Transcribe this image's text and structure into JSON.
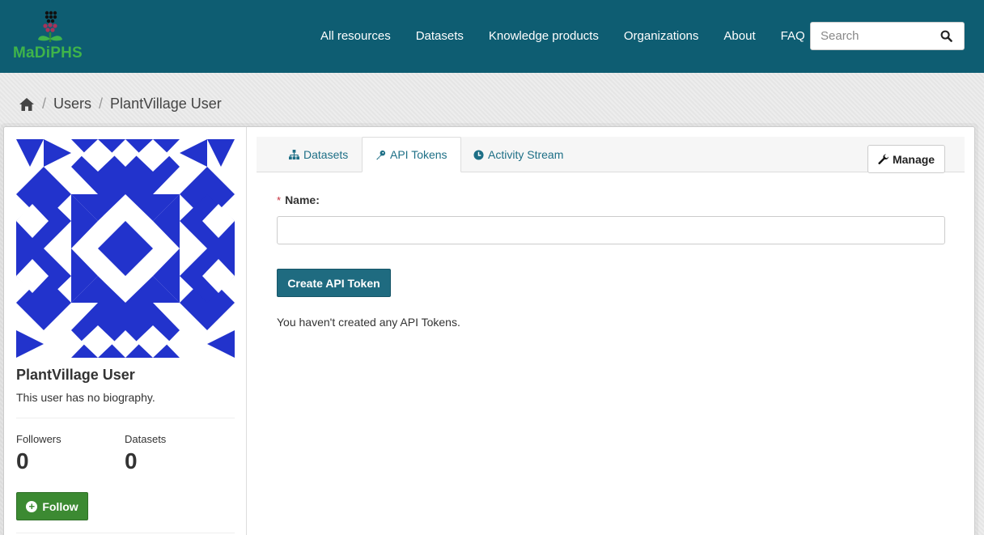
{
  "site": {
    "logo_text": "MaDiPHS",
    "colors": {
      "header": "#0e5d72",
      "logo_green": "#3fb44a",
      "accent": "#1f6b80",
      "follow": "#3c8a32",
      "avatar": "#2233cc"
    }
  },
  "nav": {
    "items": [
      {
        "label": "All resources"
      },
      {
        "label": "Datasets"
      },
      {
        "label": "Knowledge products"
      },
      {
        "label": "Organizations"
      },
      {
        "label": "About"
      },
      {
        "label": "FAQ"
      }
    ],
    "search_placeholder": "Search",
    "search_icon": "search-icon"
  },
  "breadcrumb": {
    "home_icon": "home-icon",
    "items": [
      {
        "label": "Users"
      },
      {
        "label": "PlantVillage User"
      }
    ]
  },
  "profile": {
    "name": "PlantVillage User",
    "bio": "This user has no biography.",
    "followers_label": "Followers",
    "followers_count": "0",
    "datasets_label": "Datasets",
    "datasets_count": "0",
    "follow_label": "Follow"
  },
  "tabs": [
    {
      "label": "Datasets",
      "icon": "sitemap-icon"
    },
    {
      "label": "API Tokens",
      "icon": "key-icon",
      "active": true
    },
    {
      "label": "Activity Stream",
      "icon": "clock-icon"
    }
  ],
  "manage_label": "Manage",
  "form": {
    "required_mark": "*",
    "name_label": "Name:",
    "name_value": "",
    "name_placeholder": "",
    "submit_label": "Create API Token"
  },
  "empty_message": "You haven't created any API Tokens."
}
